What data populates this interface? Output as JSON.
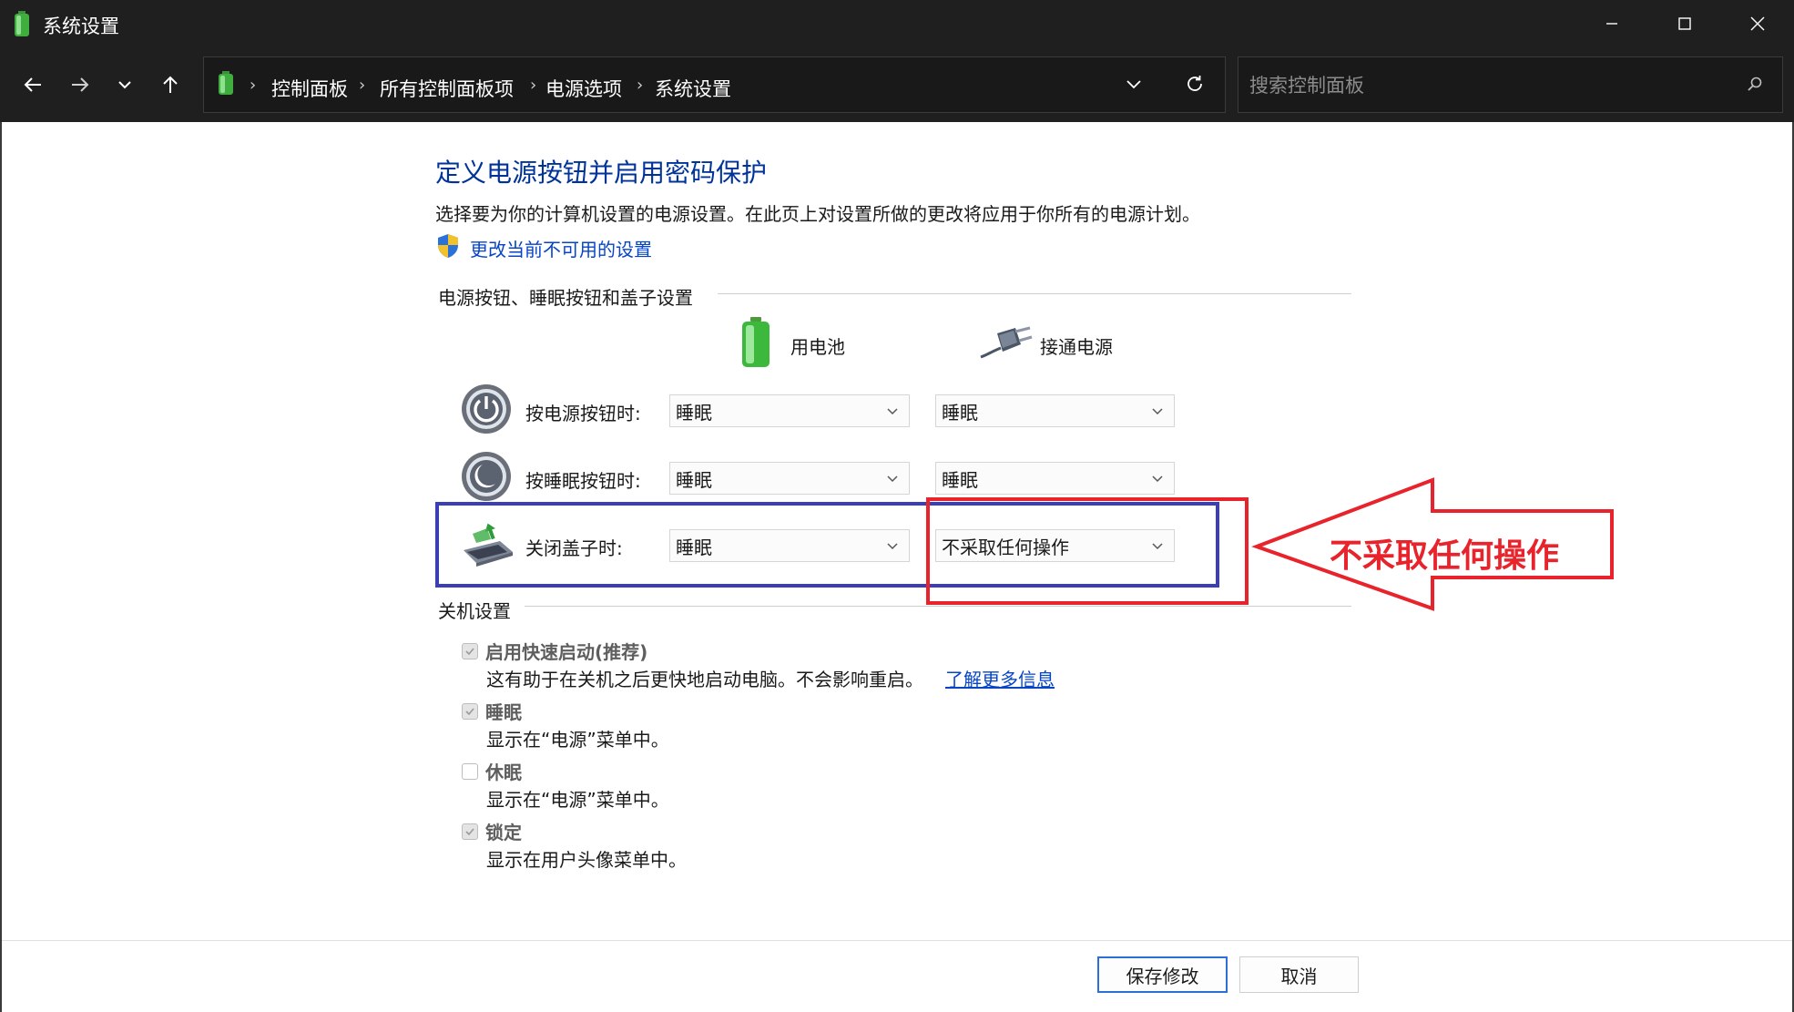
{
  "window": {
    "title": "系统设置",
    "icon": "battery-app-icon",
    "controls": [
      "minimize-icon",
      "maximize-icon",
      "close-icon"
    ]
  },
  "nav": {
    "buttons": [
      "back-arrow-icon",
      "forward-arrow-icon",
      "chevron-down-icon",
      "up-arrow-icon"
    ],
    "breadcrumb": [
      "控制面板",
      "所有控制面板项",
      "电源选项",
      "系统设置"
    ],
    "search_placeholder": "搜索控制面板"
  },
  "page": {
    "heading": "定义电源按钮并启用密码保护",
    "description": "选择要为你的计算机设置的电源设置。在此页上对设置所做的更改将应用于你所有的电源计划。",
    "change_link": "更改当前不可用的设置"
  },
  "power_buttons": {
    "group_label": "电源按钮、睡眠按钮和盖子设置",
    "col_battery": "用电池",
    "col_plugged": "接通电源",
    "rows": [
      {
        "label": "按电源按钮时:",
        "icon": "power-button-icon",
        "battery": "睡眠",
        "plugged": "睡眠"
      },
      {
        "label": "按睡眠按钮时:",
        "icon": "sleep-button-icon",
        "battery": "睡眠",
        "plugged": "睡眠"
      },
      {
        "label": "关闭盖子时:",
        "icon": "laptop-lid-icon",
        "battery": "睡眠",
        "plugged": "不采取任何操作"
      }
    ]
  },
  "shutdown": {
    "group_label": "关机设置",
    "items": [
      {
        "label": "启用快速启动(推荐)",
        "desc": "这有助于在关机之后更快地启动电脑。不会影响重启。",
        "link": "了解更多信息",
        "checked": true
      },
      {
        "label": "睡眠",
        "desc": "显示在“电源”菜单中。",
        "checked": true
      },
      {
        "label": "休眠",
        "desc": "显示在“电源”菜单中。",
        "checked": false
      },
      {
        "label": "锁定",
        "desc": "显示在用户头像菜单中。",
        "checked": true
      }
    ]
  },
  "footer": {
    "save": "保存修改",
    "cancel": "取消"
  },
  "annotation": {
    "text": "不采取任何操作",
    "color": "#e8232b",
    "box_color": "#3a3fb8"
  }
}
